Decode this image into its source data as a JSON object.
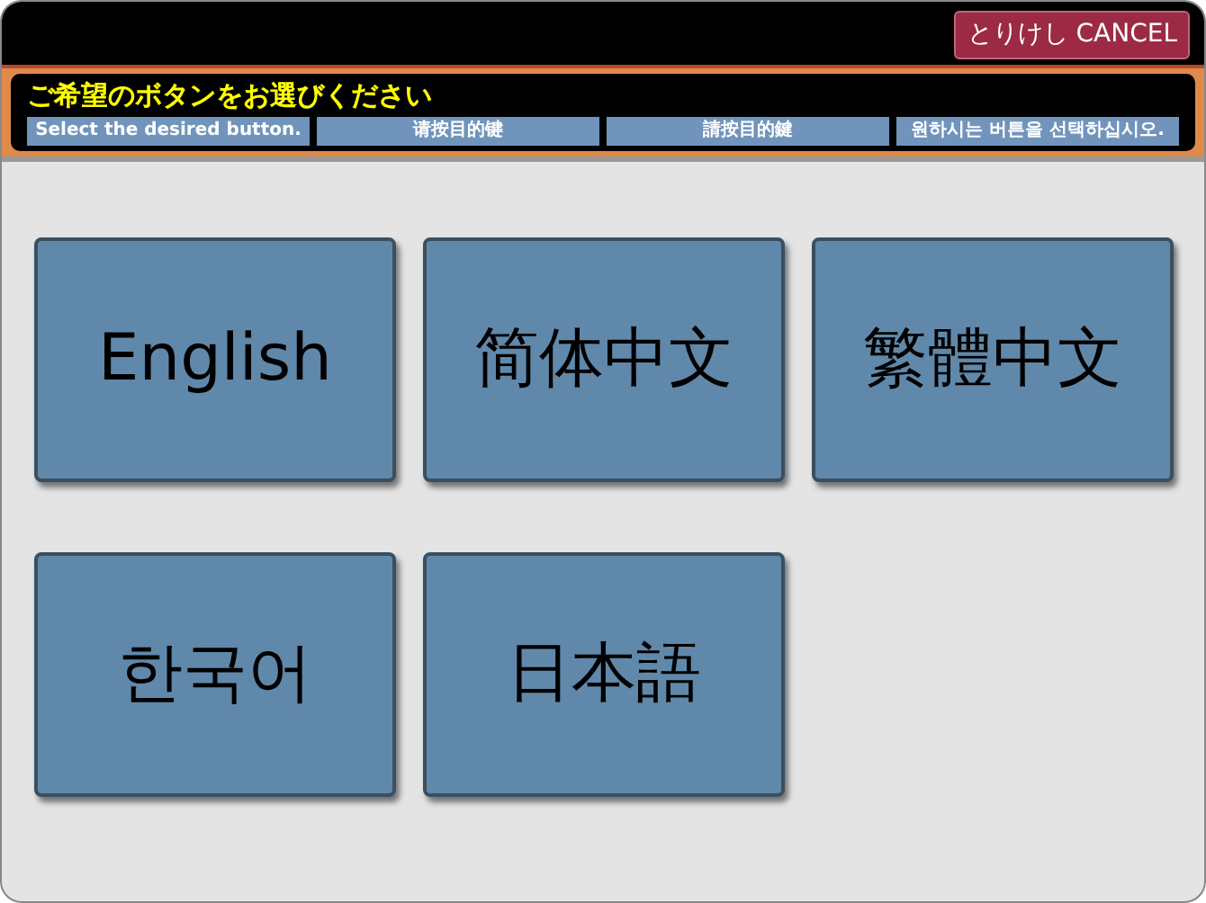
{
  "cancel_button": "とりけし CANCEL",
  "prompt": {
    "title": "ご希望のボタンをお選びください",
    "translations": [
      "Select the desired button.",
      "请按目的键",
      "請按目的鍵",
      "원하시는 버튼을 선택하십시오."
    ]
  },
  "languages": [
    {
      "label": "English"
    },
    {
      "label": "简体中文"
    },
    {
      "label": "繁體中文"
    },
    {
      "label": "한국어"
    },
    {
      "label": "日本語"
    }
  ]
}
